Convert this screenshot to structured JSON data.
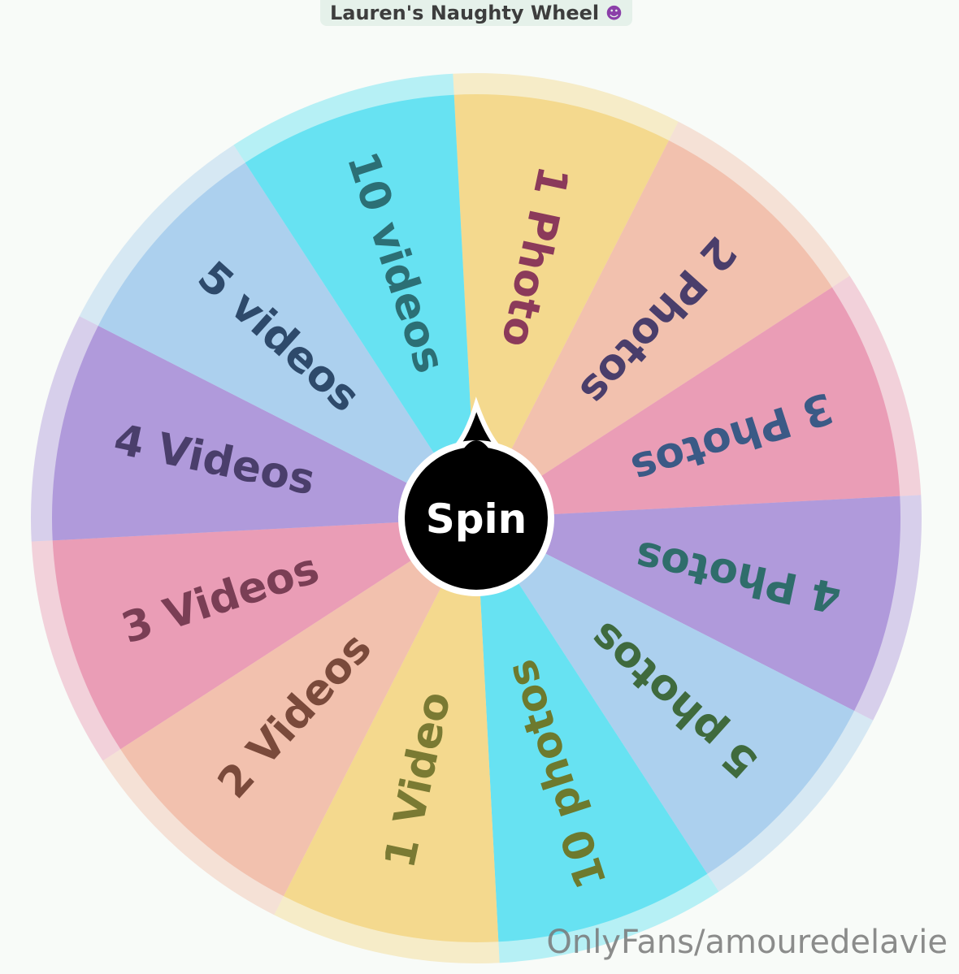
{
  "title": "Lauren's Naughty Wheel",
  "title_icon": "devil-face-icon",
  "spin_label": "Spin",
  "watermark": "OnlyFans/amouredelavie",
  "segments": [
    {
      "label": "1 Photo",
      "color": "#f4d98e",
      "text_color": "#8b3a5a"
    },
    {
      "label": "2 Photos",
      "color": "#f2c1ae",
      "text_color": "#4a3e6b"
    },
    {
      "label": "3 Photos",
      "color": "#ea9db6",
      "text_color": "#3b5a86"
    },
    {
      "label": "4 Photos",
      "color": "#b09adb",
      "text_color": "#2f6d6b"
    },
    {
      "label": "5 photos",
      "color": "#acd0ee",
      "text_color": "#3f6a3d"
    },
    {
      "label": "10 photos",
      "color": "#67e2f2",
      "text_color": "#6d7a2e"
    },
    {
      "label": "1 Video",
      "color": "#f4d98e",
      "text_color": "#7a7a33"
    },
    {
      "label": "2 Videos",
      "color": "#f2c1ae",
      "text_color": "#7a4a3b"
    },
    {
      "label": "3 Videos",
      "color": "#ea9db6",
      "text_color": "#7a3e55"
    },
    {
      "label": "4 Videos",
      "color": "#b09adb",
      "text_color": "#4a3e6b"
    },
    {
      "label": "5 videos",
      "color": "#acd0ee",
      "text_color": "#2e4a6b"
    },
    {
      "label": "10 videos",
      "color": "#67e2f2",
      "text_color": "#2c6f75"
    }
  ]
}
